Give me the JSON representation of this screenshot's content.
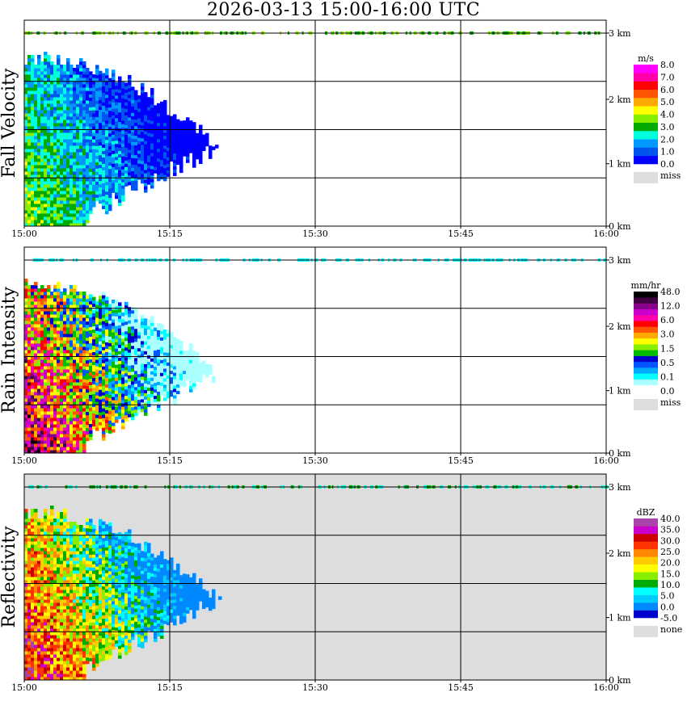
{
  "title": "2026-03-13  15:00-16:00 UTC",
  "x_ticks": [
    "15:00",
    "15:15",
    "15:30",
    "15:45",
    "16:00"
  ],
  "y_ticks": [
    "0 km",
    "1 km",
    "2 km",
    "3 km"
  ],
  "chart_data": [
    {
      "type": "heatmap",
      "title": "Fall Velocity",
      "ylabel": "Fall Velocity",
      "xlim": [
        "15:00",
        "16:00"
      ],
      "ylim_km": [
        0,
        3.2
      ],
      "grid": true,
      "unit": "m/s",
      "legend_position": "right",
      "legend": {
        "unit": "m/s",
        "colors": [
          "#0000ff",
          "#0055ee",
          "#0099ff",
          "#00ffdd",
          "#00aa00",
          "#88ee00",
          "#ffff00",
          "#ffaa00",
          "#ff5500",
          "#ff0000",
          "#ff00aa",
          "#ff00ff"
        ],
        "labels": [
          "0.0",
          "1.0",
          "2.0",
          "3.0",
          "4.0",
          "5.0",
          "6.0",
          "7.0",
          "8.0"
        ],
        "miss_label": "miss",
        "miss_color": "#dddddd"
      },
      "echo_end_time": "15:20",
      "echo_top_km": 2.6,
      "background": "#ffffff"
    },
    {
      "type": "heatmap",
      "title": "Rain Intensity",
      "ylabel": "Rain Intensity",
      "xlim": [
        "15:00",
        "16:00"
      ],
      "ylim_km": [
        0,
        3.2
      ],
      "grid": true,
      "unit": "mm/hr",
      "legend_position": "right",
      "legend": {
        "unit": "mm/hr",
        "colors": [
          "#ffffff",
          "#aaffff",
          "#00ffff",
          "#00aaff",
          "#0055ff",
          "#0000cc",
          "#00bb00",
          "#88ee00",
          "#ffff00",
          "#ffaa00",
          "#ff5500",
          "#ff0000",
          "#ff00aa",
          "#cc00cc",
          "#880088",
          "#440044",
          "#000000"
        ],
        "labels": [
          "0.0",
          "0.1",
          "0.5",
          "1.5",
          "3.0",
          "6.0",
          "12.0",
          "48.0"
        ],
        "miss_label": "miss",
        "miss_color": "#dddddd"
      },
      "echo_end_time": "15:20",
      "echo_top_km": 2.6,
      "background": "#ffffff"
    },
    {
      "type": "heatmap",
      "title": "Reflectivity",
      "ylabel": "Reflectivity",
      "xlim": [
        "15:00",
        "16:00"
      ],
      "ylim_km": [
        0,
        3.2
      ],
      "grid": true,
      "unit": "dBZ",
      "legend_position": "right",
      "legend": {
        "unit": "dBZ",
        "colors": [
          "#0000cc",
          "#0088ff",
          "#00ccff",
          "#00ffff",
          "#00aa00",
          "#88ee00",
          "#ffff00",
          "#ffcc00",
          "#ff8800",
          "#ff3300",
          "#cc0000",
          "#cc00cc",
          "#aa44aa"
        ],
        "labels": [
          "-5.0",
          "0.0",
          "5.0",
          "10.0",
          "15.0",
          "20.0",
          "25.0",
          "30.0",
          "35.0",
          "40.0"
        ],
        "miss_label": "none",
        "miss_color": "#dddddd"
      },
      "echo_end_time": "15:20",
      "echo_top_km": 2.6,
      "background": "#dddddd"
    }
  ]
}
